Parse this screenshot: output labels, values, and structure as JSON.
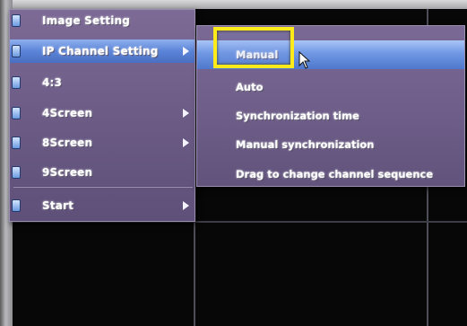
{
  "menu": {
    "items": [
      {
        "label": "Image Setting",
        "has_submenu": false,
        "selected": false
      },
      {
        "label": "IP Channel Setting",
        "has_submenu": true,
        "selected": true
      },
      {
        "label": "4:3",
        "has_submenu": false,
        "selected": false
      },
      {
        "label": "4Screen",
        "has_submenu": true,
        "selected": false
      },
      {
        "label": "8Screen",
        "has_submenu": true,
        "selected": false
      },
      {
        "label": "9Screen",
        "has_submenu": false,
        "selected": false
      },
      {
        "label": "Start",
        "has_submenu": true,
        "selected": false
      }
    ]
  },
  "submenu": {
    "items": [
      {
        "label": "Manual",
        "selected": true
      },
      {
        "label": "Auto",
        "selected": false
      },
      {
        "label": "Synchronization time",
        "selected": false
      },
      {
        "label": "Manual synchronization",
        "selected": false
      },
      {
        "label": "Drag to change channel sequence",
        "selected": false
      }
    ]
  },
  "colors": {
    "menu_background": "#6a5a84",
    "selection": "#5b84d8",
    "highlight_annotation": "#ffeb1a"
  }
}
